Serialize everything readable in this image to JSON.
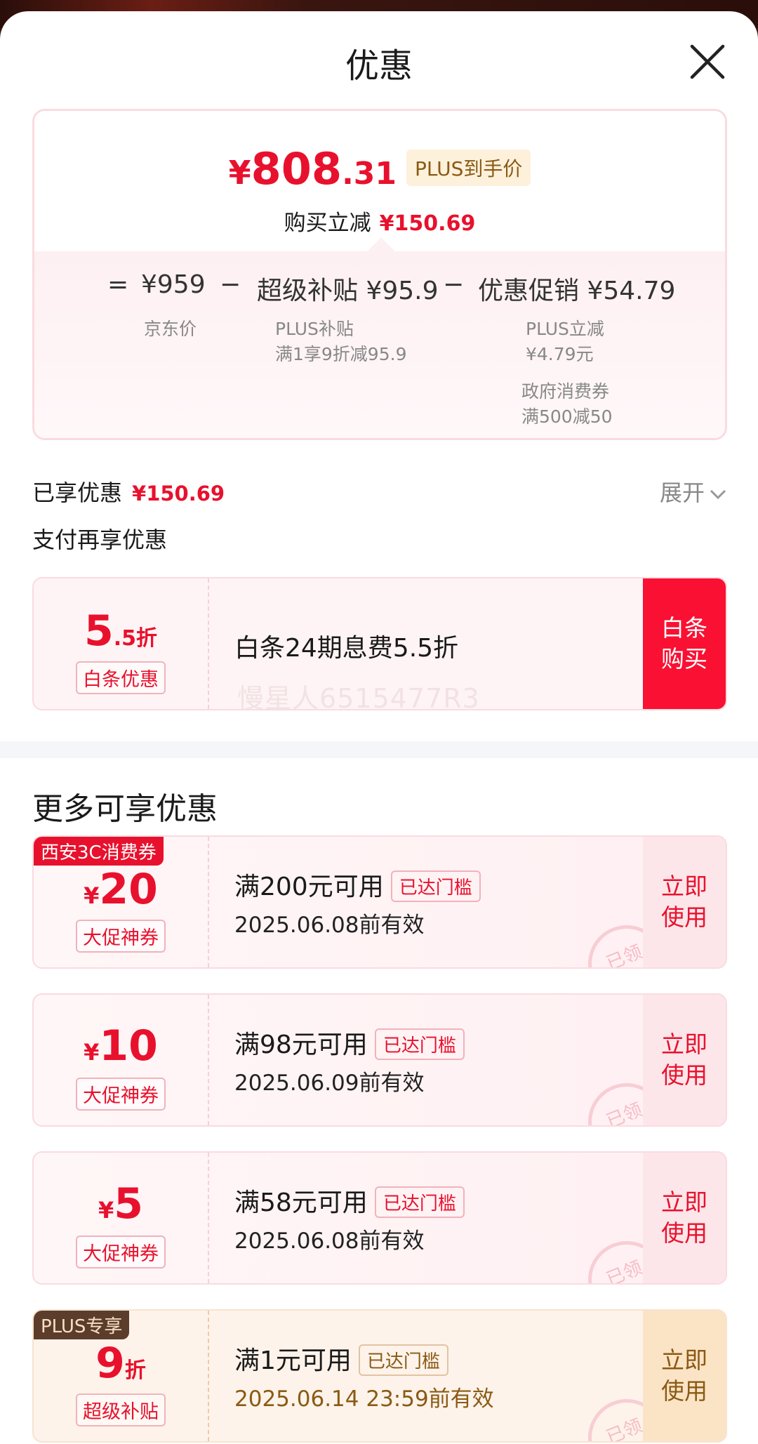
{
  "header": {
    "title": "优惠"
  },
  "summary": {
    "price_yen": "¥",
    "price_int": "808",
    "price_dec": ".31",
    "plus_badge": "PLUS到手价",
    "reduce_label": "购买立减",
    "reduce_value": "¥150.69",
    "formula": {
      "eq": "=",
      "jd_price": "¥959",
      "minus1": "−",
      "super_subsidy": "超级补贴 ¥95.9",
      "minus2": "−",
      "promo": "优惠促销 ¥54.79",
      "jd_price_label": "京东价",
      "plus_subsidy_title": "PLUS补贴",
      "plus_subsidy_desc": "满1享9折减95.9",
      "plus_reduce_title": "PLUS立减",
      "plus_reduce_value": "¥4.79元",
      "gov_title": "政府消费券",
      "gov_desc": "满500减50"
    }
  },
  "enjoyed": {
    "label": "已享优惠",
    "value": "¥150.69",
    "expand": "展开"
  },
  "pay": {
    "title": "支付再享优惠",
    "card": {
      "value_big": "5",
      "value_small": ".5折",
      "tag": "白条优惠",
      "desc": "白条24期息费5.5折",
      "watermark": "慢星人6515477R3",
      "button_line1": "白条",
      "button_line2": "购买"
    }
  },
  "more": {
    "title": "更多可享优惠",
    "coupons": [
      {
        "corner": "西安3C消费券",
        "yen": "¥",
        "amount": "20",
        "tag": "大促神券",
        "condition": "满200元可用",
        "reached": "已达门槛",
        "date": "2025.06.08前有效",
        "btn1": "立即",
        "btn2": "使用",
        "stamp": "已领"
      },
      {
        "corner": "",
        "yen": "¥",
        "amount": "10",
        "tag": "大促神券",
        "condition": "满98元可用",
        "reached": "已达门槛",
        "date": "2025.06.09前有效",
        "btn1": "立即",
        "btn2": "使用",
        "stamp": "已领"
      },
      {
        "corner": "",
        "yen": "¥",
        "amount": "5",
        "tag": "大促神券",
        "condition": "满58元可用",
        "reached": "已达门槛",
        "date": "2025.06.08前有效",
        "btn1": "立即",
        "btn2": "使用",
        "stamp": "已领"
      },
      {
        "corner": "PLUS专享",
        "amount": "9",
        "zhe": "折",
        "tag": "超级补贴",
        "condition": "满1元可用",
        "reached": "已达门槛",
        "date": "2025.06.14 23:59前有效",
        "btn1": "立即",
        "btn2": "使用",
        "stamp": "已领"
      }
    ]
  },
  "colors": {
    "accent": "#e8112d",
    "button_red": "#fa1032",
    "plus_brown": "#8a5a14"
  }
}
